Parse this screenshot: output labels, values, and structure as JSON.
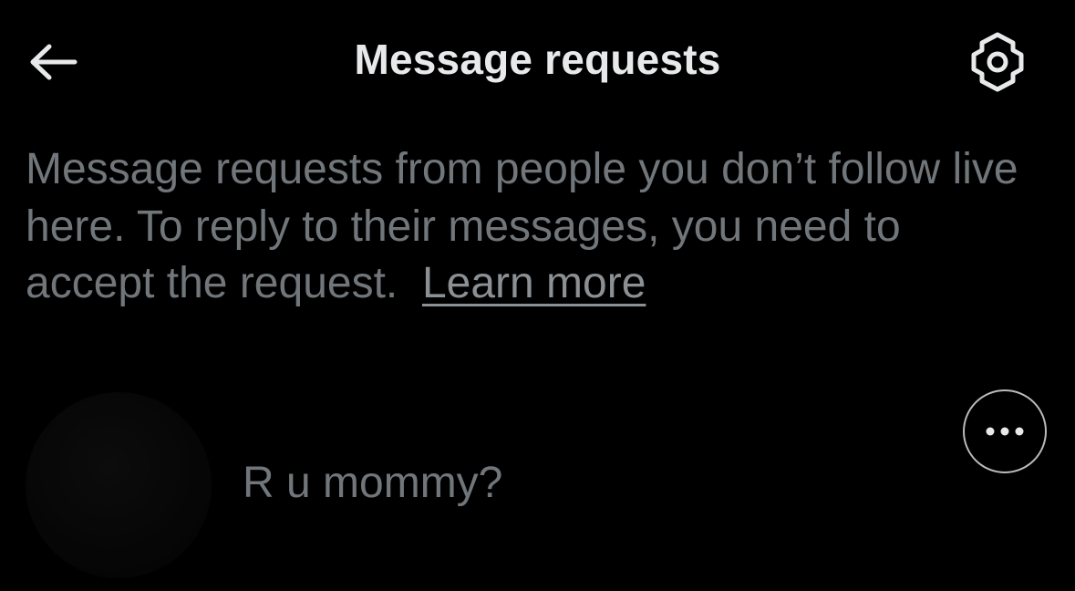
{
  "header": {
    "back_icon": "arrow-left-icon",
    "title": "Message requests",
    "settings_icon": "gear-icon"
  },
  "info": {
    "text": "Message requests from people you don’t follow live here. To reply to their messages, you need to accept the request.",
    "learn_more": "Learn more"
  },
  "requests": [
    {
      "sender": "",
      "preview": "R u mommy?",
      "more_icon": "more-horizontal-icon"
    }
  ],
  "colors": {
    "background": "#000000",
    "title": "#e7e9ea",
    "secondary_text": "#71767b",
    "icon_border": "#b9bbbd"
  }
}
